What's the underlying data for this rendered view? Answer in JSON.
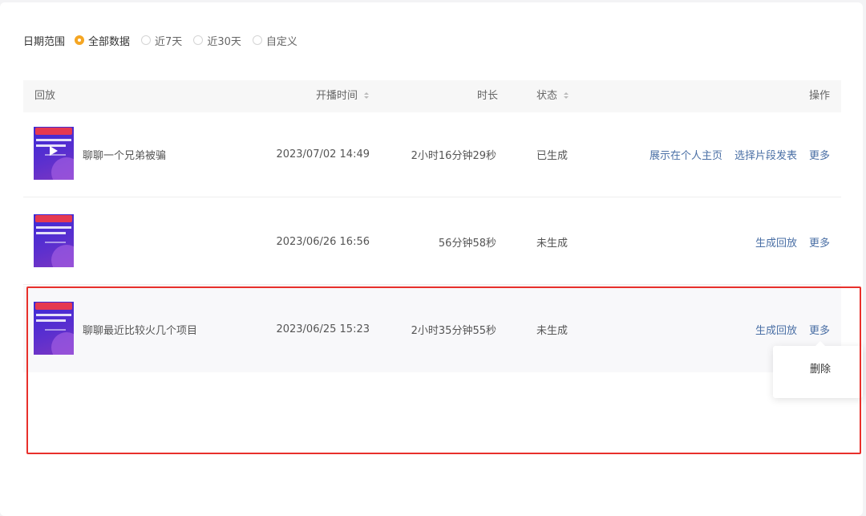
{
  "filter": {
    "label": "日期范围",
    "options": [
      {
        "label": "全部数据",
        "checked": true
      },
      {
        "label": "近7天",
        "checked": false
      },
      {
        "label": "近30天",
        "checked": false
      },
      {
        "label": "自定义",
        "checked": false
      }
    ]
  },
  "table": {
    "headers": {
      "replay": "回放",
      "start_time": "开播时间",
      "duration": "时长",
      "status": "状态",
      "actions": "操作"
    },
    "rows": [
      {
        "title": "聊聊一个兄弟被骗",
        "time": "2023/07/02 14:49",
        "duration": "2小时16分钟29秒",
        "status": "已生成",
        "actions": [
          "展示在个人主页",
          "选择片段发表",
          "更多"
        ]
      },
      {
        "title": "",
        "time": "2023/06/26 16:56",
        "duration": "56分钟58秒",
        "status": "未生成",
        "actions": [
          "生成回放",
          "更多"
        ]
      },
      {
        "title": "聊聊最近比较火几个项目",
        "time": "2023/06/25 15:23",
        "duration": "2小时35分钟55秒",
        "status": "未生成",
        "actions": [
          "生成回放",
          "更多"
        ]
      }
    ]
  },
  "dropdown": {
    "delete_label": "删除"
  },
  "colors": {
    "accent": "#f5a623",
    "link": "#4a6fa5",
    "highlight": "#e8302b"
  }
}
